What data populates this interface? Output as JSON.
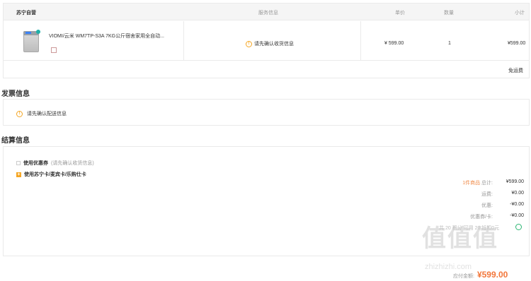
{
  "order": {
    "header": {
      "store": "苏宁自营",
      "service": "服务信息",
      "price": "单价",
      "quantity": "数量",
      "subtotal": "小计"
    },
    "item": {
      "name": "VIOMI/云米 WM7TP-S3A 7KG公斤宿舍家用全自动...",
      "service_note": "请先确认收货信息",
      "price": "¥ 599.00",
      "quantity": "1",
      "subtotal": "¥599.00"
    },
    "shipping_label": "免运费"
  },
  "invoice": {
    "title": "发票信息",
    "note": "请先确认配送信息"
  },
  "settlement": {
    "title": "结算信息",
    "coupon_label": "使用优惠券",
    "coupon_hint": "(请先确认收货信息)",
    "card_label": "使用苏宁卡/麦宾卡/乐购仕卡",
    "summary": [
      {
        "key_prefix": "1件商品",
        "key": "总计:",
        "value": "¥599.00"
      },
      {
        "key_prefix": "",
        "key": "运费:",
        "value": "¥0.00"
      },
      {
        "key_prefix": "",
        "key": "优惠:",
        "value": "-¥0.00"
      },
      {
        "key_prefix": "",
        "key": "优惠券/卡:",
        "value": "-¥0.00"
      }
    ],
    "faint_text": "共 20 积分 可用 20 抵扣0元"
  },
  "total": {
    "label": "应付金额:",
    "value": "¥599.00"
  },
  "watermark": {
    "glyphs": "值值值",
    "site": "zhizhizhi.com"
  }
}
